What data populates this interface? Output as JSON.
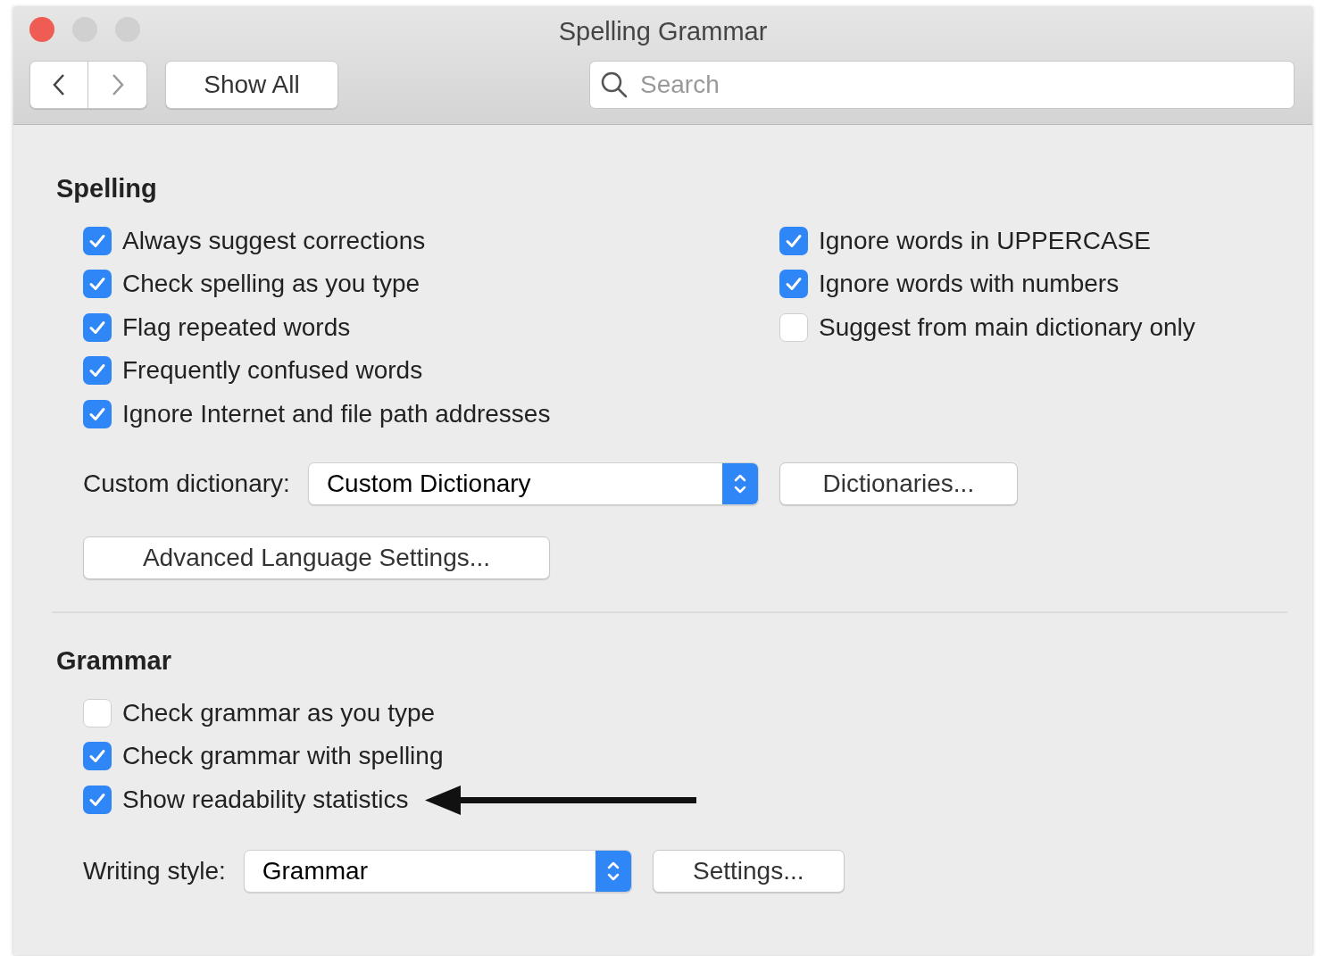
{
  "window": {
    "title": "Spelling Grammar"
  },
  "toolbar": {
    "show_all": "Show All",
    "search": {
      "placeholder": "Search"
    }
  },
  "spelling": {
    "heading": "Spelling",
    "left_options": [
      {
        "label": "Always suggest corrections",
        "checked": true
      },
      {
        "label": "Check spelling as you type",
        "checked": true
      },
      {
        "label": "Flag repeated words",
        "checked": true
      },
      {
        "label": "Frequently confused words",
        "checked": true
      },
      {
        "label": "Ignore Internet and file path addresses",
        "checked": true
      }
    ],
    "right_options": [
      {
        "label": "Ignore words in UPPERCASE",
        "checked": true
      },
      {
        "label": "Ignore words with numbers",
        "checked": true
      },
      {
        "label": "Suggest from main dictionary only",
        "checked": false
      }
    ],
    "custom_dictionary": {
      "label": "Custom dictionary:",
      "value": "Custom Dictionary"
    },
    "dictionaries_button": "Dictionaries...",
    "advanced_button": "Advanced Language Settings..."
  },
  "grammar": {
    "heading": "Grammar",
    "options": [
      {
        "label": "Check grammar as you type",
        "checked": false
      },
      {
        "label": "Check grammar with spelling",
        "checked": true
      },
      {
        "label": "Show readability statistics",
        "checked": true
      }
    ],
    "writing_style": {
      "label": "Writing style:",
      "value": "Grammar"
    },
    "settings_button": "Settings..."
  }
}
